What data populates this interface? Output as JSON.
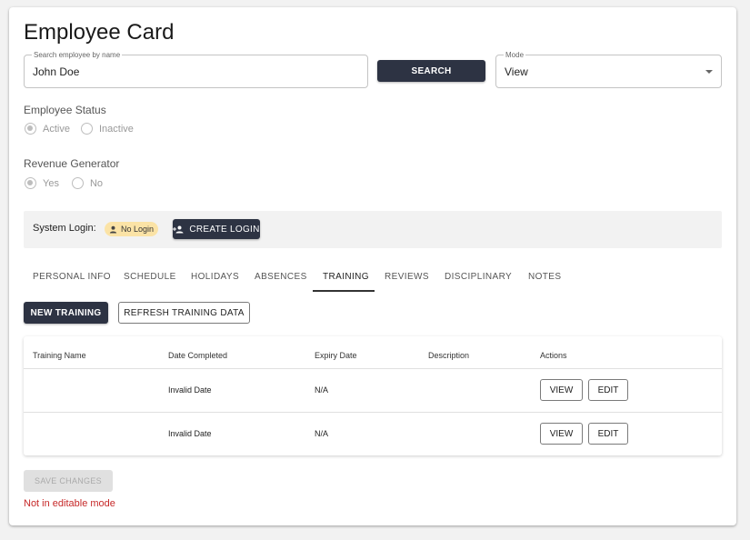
{
  "page": {
    "title": "Employee Card"
  },
  "search": {
    "label": "Search employee by name",
    "value": "John Doe",
    "button_label": "SEARCH"
  },
  "mode": {
    "label": "Mode",
    "value": "View"
  },
  "employee_status": {
    "label": "Employee Status",
    "options": [
      {
        "label": "Active",
        "checked": true
      },
      {
        "label": "Inactive",
        "checked": false
      }
    ]
  },
  "revenue_generator": {
    "label": "Revenue Generator",
    "options": [
      {
        "label": "Yes",
        "checked": true
      },
      {
        "label": "No",
        "checked": false
      }
    ]
  },
  "system_login": {
    "label": "System Login:",
    "badge": "No Login",
    "button_label": "CREATE LOGIN"
  },
  "tabs": [
    {
      "label": "PERSONAL INFO"
    },
    {
      "label": "SCHEDULE"
    },
    {
      "label": "HOLIDAYS"
    },
    {
      "label": "ABSENCES"
    },
    {
      "label": "TRAINING",
      "active": true
    },
    {
      "label": "REVIEWS"
    },
    {
      "label": "DISCIPLINARY"
    },
    {
      "label": "NOTES"
    }
  ],
  "training": {
    "new_button": "NEW TRAINING",
    "refresh_button": "REFRESH TRAINING DATA",
    "columns": [
      "Training Name",
      "Date Completed",
      "Expiry Date",
      "Description",
      "Actions"
    ],
    "rows": [
      {
        "name": "",
        "date_completed": "Invalid Date",
        "expiry": "N/A",
        "description": "",
        "view": "VIEW",
        "edit": "EDIT"
      },
      {
        "name": "",
        "date_completed": "Invalid Date",
        "expiry": "N/A",
        "description": "",
        "view": "VIEW",
        "edit": "EDIT"
      }
    ]
  },
  "footer": {
    "save_button": "SAVE CHANGES",
    "error_text": "Not in editable mode"
  },
  "colors": {
    "primary_dark": "#2d3343",
    "badge_bg": "#fbe3a6",
    "error": "#c62828",
    "active_tab_underline": "#333333"
  }
}
